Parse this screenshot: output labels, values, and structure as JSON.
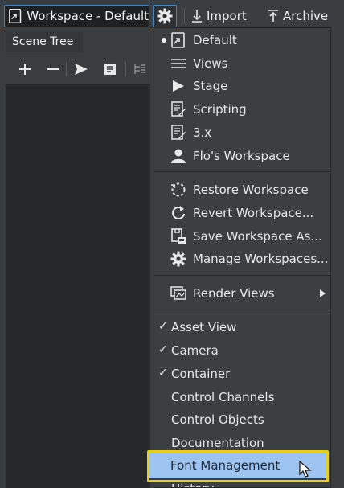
{
  "toolbar": {
    "workspace_label": "Workspace - Default",
    "import_label": "Import",
    "archive_label": "Archive"
  },
  "tab": {
    "scene_tree": "Scene Tree"
  },
  "menu": {
    "workspaces": [
      {
        "label": "Default",
        "icon": "bullet",
        "selected": true
      },
      {
        "label": "Views",
        "icon": "lines-icon"
      },
      {
        "label": "Stage",
        "icon": "play-icon"
      },
      {
        "label": "Scripting",
        "icon": "script-icon"
      },
      {
        "label": "3.x",
        "icon": "script-icon"
      },
      {
        "label": "Flo's Workspace",
        "icon": "user-icon"
      }
    ],
    "actions": [
      {
        "label": "Restore Workspace",
        "icon": "restore-icon"
      },
      {
        "label": "Revert Workspace...",
        "icon": "revert-icon"
      },
      {
        "label": "Save Workspace As...",
        "icon": "save-icon"
      },
      {
        "label": "Manage Workspaces...",
        "icon": "gear-icon"
      }
    ],
    "render_views": {
      "label": "Render Views",
      "icon": "render-views-icon",
      "has_submenu": true
    },
    "panels": [
      {
        "label": "Asset View",
        "checked": true
      },
      {
        "label": "Camera",
        "checked": true
      },
      {
        "label": "Container",
        "checked": true
      },
      {
        "label": "Control Channels",
        "checked": false
      },
      {
        "label": "Control Objects",
        "checked": false
      },
      {
        "label": "Documentation",
        "checked": false
      },
      {
        "label": "Font Management",
        "checked": false,
        "highlighted": true
      },
      {
        "label": "History",
        "checked": false
      }
    ]
  },
  "colors": {
    "menu_bg": "#3c3f42",
    "highlight_bg": "#9dc3f0",
    "highlight_border": "#e8cf1c",
    "focus_border": "#3a87c8"
  }
}
